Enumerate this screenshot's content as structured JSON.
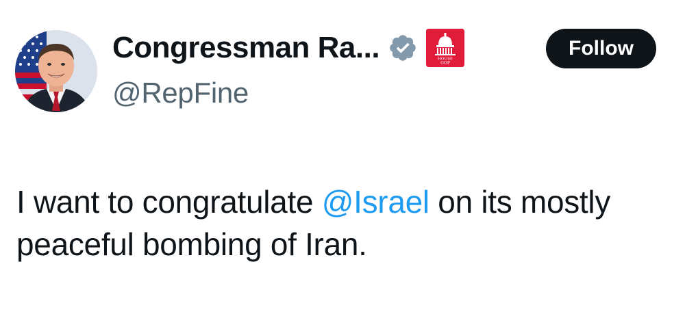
{
  "author": {
    "display_name": "Congressman Ra...",
    "handle": "@RepFine",
    "avatar_icon": "profile-photo",
    "verified_icon": "verified-badge-icon",
    "verified_color": "#829aab",
    "affiliation_badge": {
      "icon": "house-gop-logo",
      "color": "#e11b3a",
      "text_line1": "HOUSE",
      "text_line2": "GOP"
    }
  },
  "follow_button": {
    "label": "Follow",
    "background": "#0f1419",
    "text_color": "#ffffff"
  },
  "tweet": {
    "text_before": "I want to congratulate ",
    "mention": "@Israel",
    "text_after": " on its mostly peaceful bombing of Iran.",
    "mention_color": "#1d9bf0"
  }
}
